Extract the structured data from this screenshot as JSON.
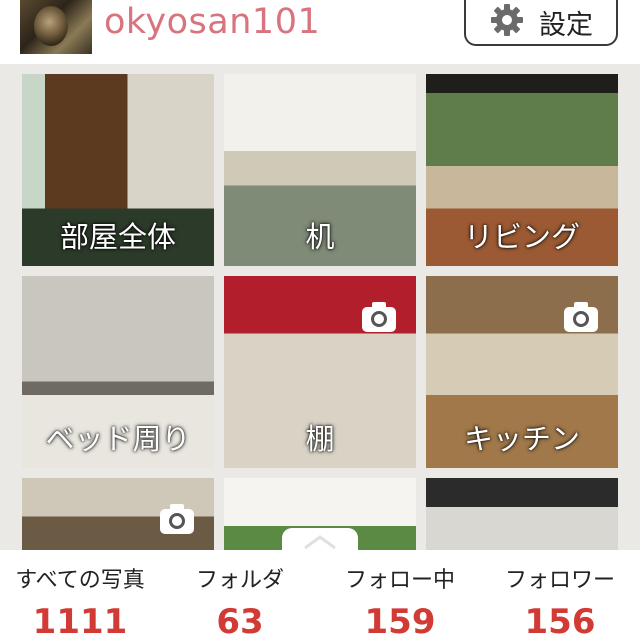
{
  "header": {
    "username": "okyosan101",
    "settings_label": "設定",
    "settings_icon": "gear-icon"
  },
  "folders": [
    {
      "label": "部屋全体",
      "camera": false
    },
    {
      "label": "机",
      "camera": false
    },
    {
      "label": "リビング",
      "camera": false
    },
    {
      "label": "ベッド周り",
      "camera": false
    },
    {
      "label": "棚",
      "camera": true
    },
    {
      "label": "キッチン",
      "camera": true
    },
    {
      "label": "",
      "camera": true
    },
    {
      "label": "",
      "camera": false
    },
    {
      "label": "",
      "camera": false
    }
  ],
  "stats": [
    {
      "label": "すべての写真",
      "value": "1111"
    },
    {
      "label": "フォルダ",
      "value": "63"
    },
    {
      "label": "フォロー中",
      "value": "159"
    },
    {
      "label": "フォロワー",
      "value": "156"
    }
  ],
  "colors": {
    "username": "#d9737d",
    "stat_value": "#d23b35",
    "grid_background": "#ebe9e5"
  }
}
